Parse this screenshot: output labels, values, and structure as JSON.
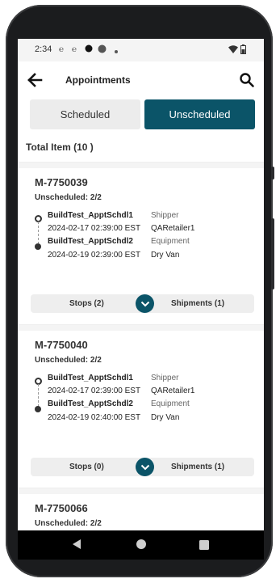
{
  "status_bar": {
    "time": "2:34",
    "icons": [
      "sim-icon",
      "sim-icon",
      "record-dot-icon",
      "circle-icon",
      "small-dot-icon",
      "wifi-icon",
      "battery-icon"
    ]
  },
  "header": {
    "title": "Appointments",
    "back_icon": "arrow-left-icon",
    "search_icon": "search-icon"
  },
  "tabs": [
    {
      "label": "Scheduled",
      "active": false
    },
    {
      "label": "Unscheduled",
      "active": true
    }
  ],
  "colors": {
    "accent": "#0b5468",
    "inactive_tab": "#ececec"
  },
  "total_items": "Total Item (10 )",
  "appointments": [
    {
      "id": "M-7750039",
      "status": "Unscheduled: 2/2",
      "stops": [
        {
          "name": "BuildTest_ApptSchdl1",
          "label": "Shipper",
          "date": "2024-02-17 02:39:00 EST",
          "value": "QARetailer1"
        },
        {
          "name": "BuildTest_ApptSchdl2",
          "label": "Equipment",
          "date": "2024-02-19 02:39:00 EST",
          "value": "Dry Van"
        }
      ],
      "stops_count": "Stops (2)",
      "shipments_count": "Shipments (1)"
    },
    {
      "id": "M-7750040",
      "status": "Unscheduled: 2/2",
      "stops": [
        {
          "name": "BuildTest_ApptSchdl1",
          "label": "Shipper",
          "date": "2024-02-17 02:39:00 EST",
          "value": "QARetailer1"
        },
        {
          "name": "BuildTest_ApptSchdl2",
          "label": "Equipment",
          "date": "2024-02-19 02:40:00 EST",
          "value": "Dry Van"
        }
      ],
      "stops_count": "Stops (0)",
      "shipments_count": "Shipments (1)"
    },
    {
      "id": "M-7750066",
      "status": "Unscheduled: 2/2"
    }
  ],
  "nav_bar": {
    "icons": [
      "back-triangle-icon",
      "home-circle-icon",
      "recents-square-icon"
    ]
  }
}
